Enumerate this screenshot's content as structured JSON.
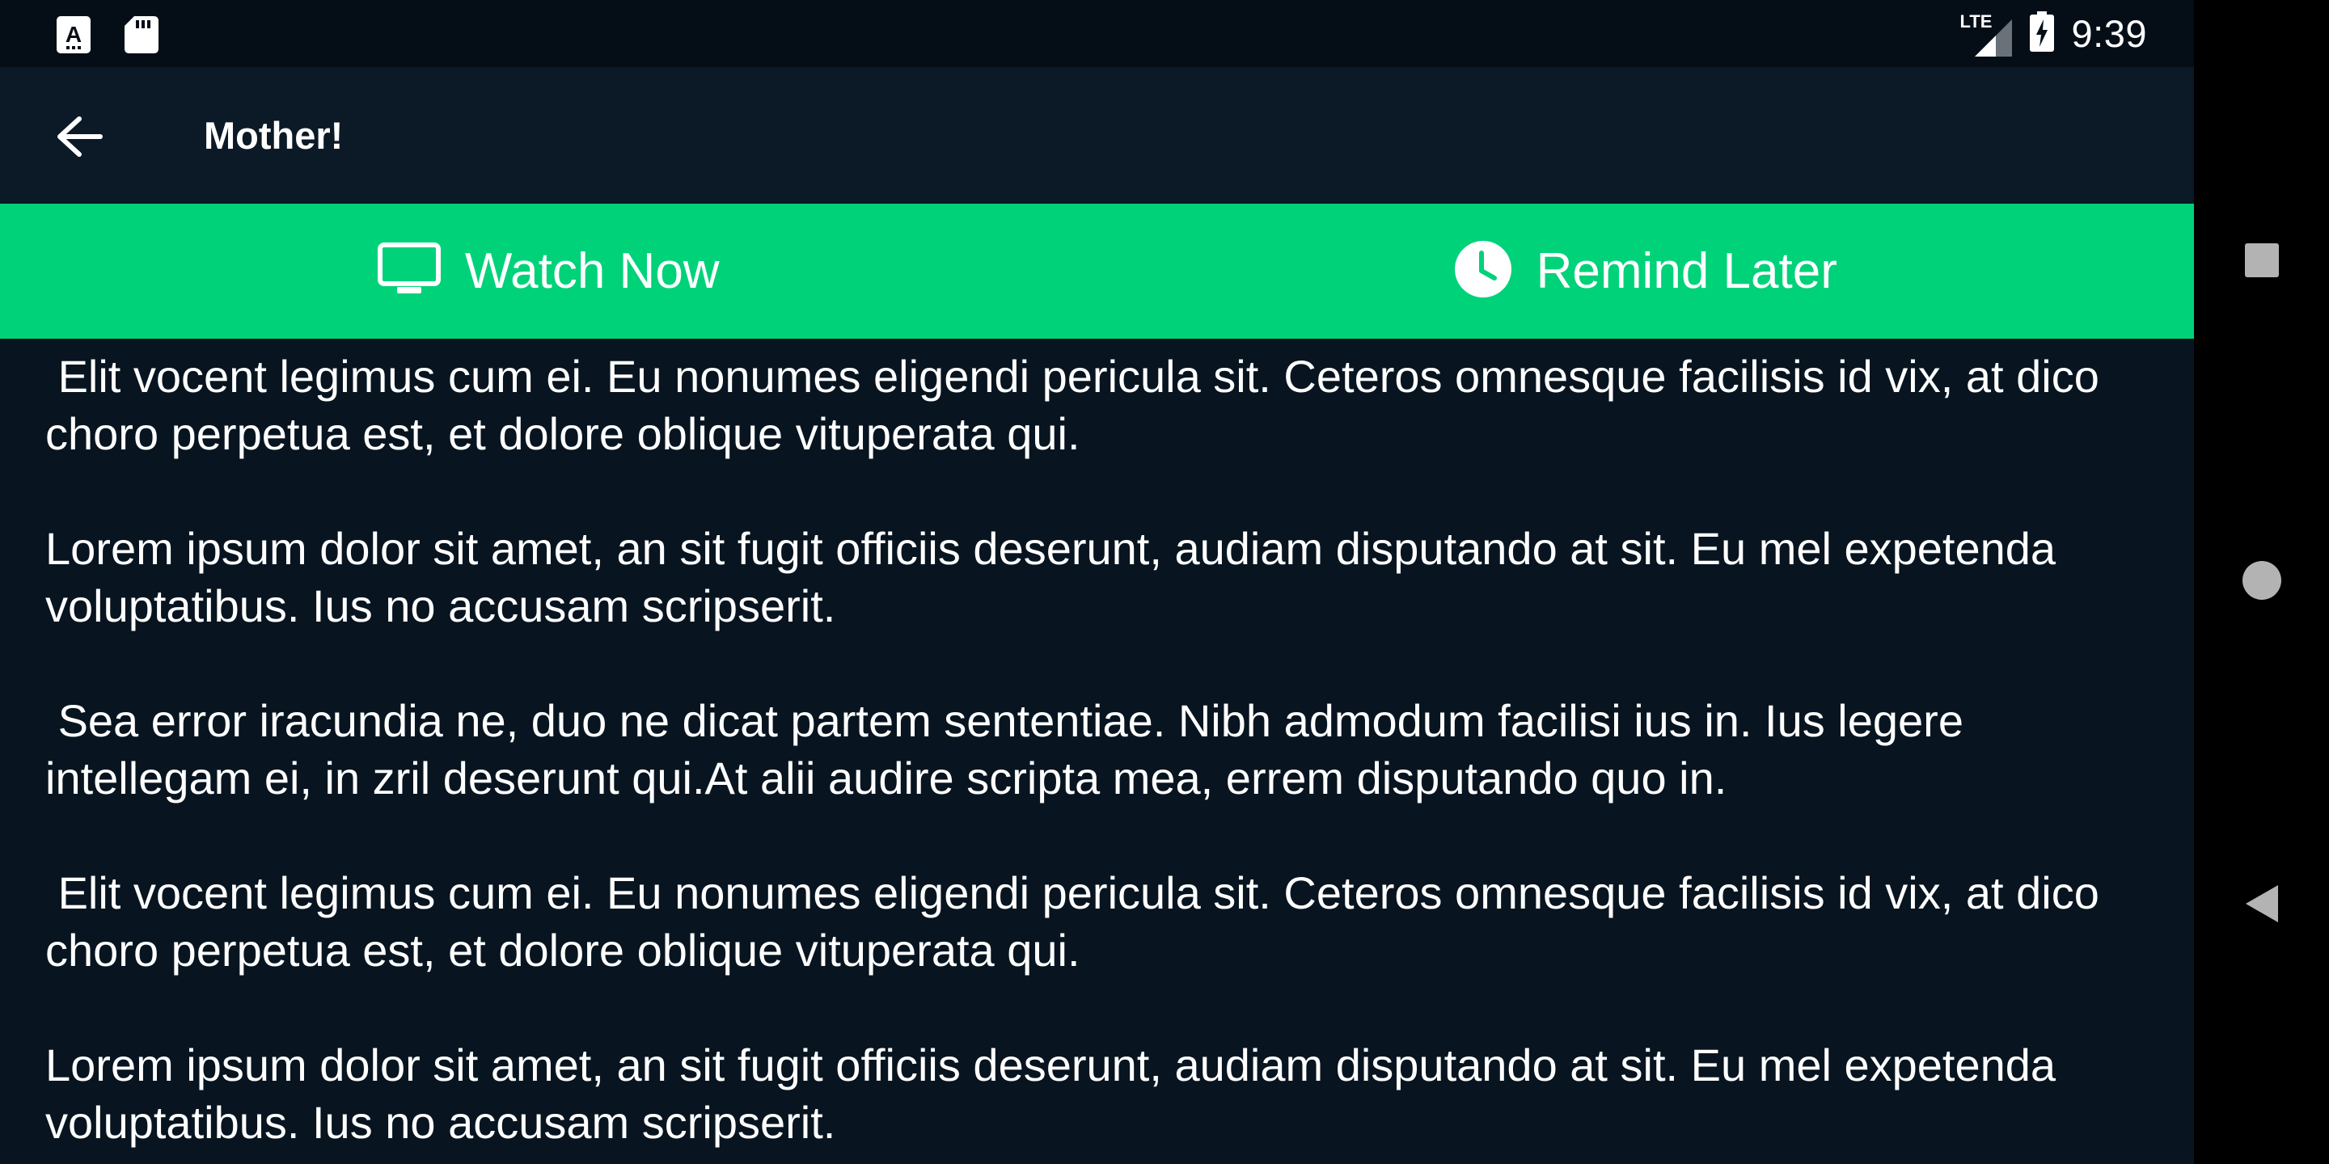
{
  "status_bar": {
    "time": "9:39",
    "network": "LTE",
    "left_icons": [
      "font-a-icon",
      "sd-card-icon"
    ],
    "right_icons": [
      "lte-signal-icon",
      "battery-charging-icon"
    ]
  },
  "app_bar": {
    "title": "Mother!",
    "back_icon": "arrow-back-icon"
  },
  "actions": {
    "watch_now": {
      "label": "Watch Now",
      "icon": "tv-icon"
    },
    "remind_later": {
      "label": "Remind Later",
      "icon": "clock-icon"
    }
  },
  "content": {
    "paragraphs": [
      " Elit vocent legimus cum ei. Eu nonumes eligendi pericula sit. Ceteros omnesque facilisis id vix, at dico choro perpetua est, et dolore oblique vituperata qui.",
      "Lorem ipsum dolor sit amet, an sit fugit officiis deserunt, audiam disputando at sit. Eu mel expetenda voluptatibus. Ius no accusam scripserit.",
      " Sea error iracundia ne, duo ne dicat partem sententiae. Nibh admodum facilisi ius in. Ius legere intellegam ei, in zril deserunt qui.At alii audire scripta mea, errem disputando quo in.",
      " Elit vocent legimus cum ei. Eu nonumes eligendi pericula sit. Ceteros omnesque facilisis id vix, at dico choro perpetua est, et dolore oblique vituperata qui.",
      "Lorem ipsum dolor sit amet, an sit fugit officiis deserunt, audiam disputando at sit. Eu mel expetenda voluptatibus. Ius no accusam scripserit."
    ]
  },
  "nav_bar": {
    "buttons": [
      "recents-square-icon",
      "home-circle-icon",
      "back-triangle-icon"
    ]
  },
  "colors": {
    "background": "#081520",
    "app_bar": "#0b1a26",
    "status_bar": "#050e16",
    "accent": "#00d27a",
    "text": "#ffffff"
  }
}
